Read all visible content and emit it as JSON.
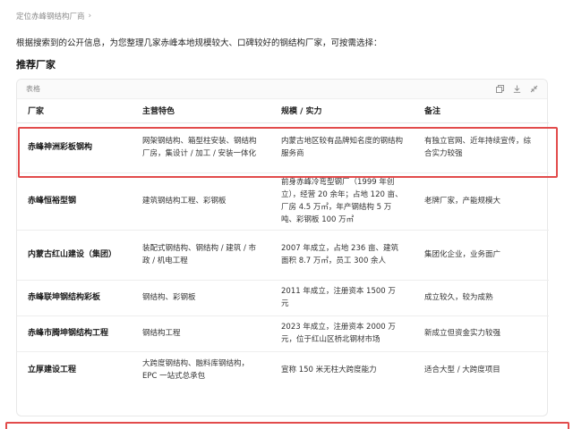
{
  "breadcrumb": {
    "text": "定位赤峰钢结构厂商"
  },
  "intro": "根据搜索到的公开信息，为您整理几家赤峰本地规模较大、口碑较好的钢结构厂家，可按需选择：",
  "section_title": "推荐厂家",
  "table": {
    "label": "表格",
    "headers": [
      "厂家",
      "主营特色",
      "规模 / 实力",
      "备注"
    ],
    "rows": [
      {
        "name": "赤峰神洲彩板钢构",
        "feature": "网架钢结构、箱型柱安装、钢结构厂房，集设计 / 加工 / 安装一体化",
        "scale": "内蒙古地区较有品牌知名度的钢结构服务商",
        "note": "有独立官网、近年持续宣传，综合实力较强"
      },
      {
        "name": "赤峰恒裕型钢",
        "feature": "建筑钢结构工程、彩钢板",
        "scale": "前身赤峰冷弯型钢厂（1999 年创立），经营 20 余年；占地 120 亩、厂房 4.5 万㎡，年产钢结构 5 万吨、彩钢板 100 万㎡",
        "note": "老牌厂家，产能规模大"
      },
      {
        "name": "内蒙古红山建设（集团）",
        "feature": "装配式钢结构、钢结构 / 建筑 / 市政 / 机电工程",
        "scale": "2007 年成立，占地 236 亩、建筑面积 8.7 万㎡，员工 300 余人",
        "note": "集团化企业，业务面广"
      },
      {
        "name": "赤峰联坤钢结构彩板",
        "feature": "钢结构、彩钢板",
        "scale": "2011 年成立，注册资本 1500 万元",
        "note": "成立较久，较为成熟"
      },
      {
        "name": "赤峰市腾坤钢结构工程",
        "feature": "钢结构工程",
        "scale": "2023 年成立，注册资本 2000 万元，位于红山区桥北钢材市场",
        "note": "新成立但资金实力较强"
      },
      {
        "name": "立厚建设工程",
        "feature": "大跨度钢结构、融料库钢结构，EPC 一站式总承包",
        "scale": "宣称 150 米无柱大跨度能力",
        "note": "适合大型 / 大跨度项目"
      }
    ]
  },
  "colors": {
    "highlight": "#e24b4b",
    "border": "#e8e8e8",
    "muted": "#8a8a8a"
  },
  "icons": [
    "chevron-right-icon",
    "copy-icon",
    "download-icon",
    "collapse-icon"
  ]
}
